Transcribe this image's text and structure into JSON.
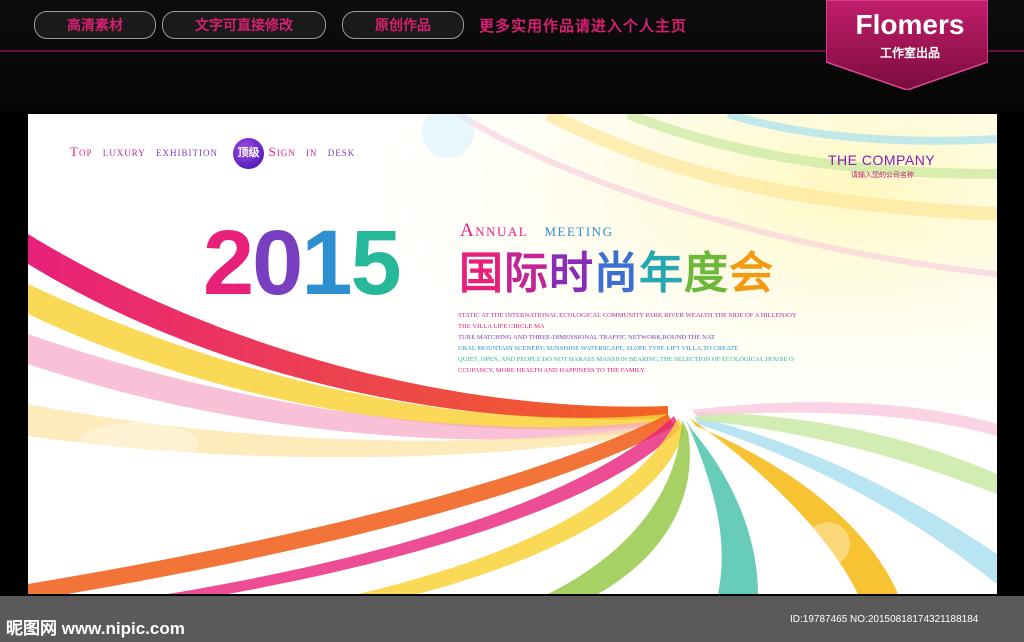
{
  "top_bar": {
    "pills": [
      "高清素材",
      "文字可直接修改",
      "原创作品"
    ],
    "promo_text": "更多实用作品请进入个人主页",
    "brand_name": "Flomers",
    "brand_sub": "工作室出品"
  },
  "board": {
    "luxury_words": [
      "Top",
      "luxury",
      "exhibition"
    ],
    "badge": "顶级",
    "sign_words": [
      "Sign",
      "in",
      "desk"
    ],
    "company": "THE COMPANY",
    "company_sub": "请输入您的公司名称",
    "year_digits": [
      "2",
      "0",
      "1",
      "5"
    ],
    "annual_words": [
      "Annual",
      "meeting"
    ],
    "title_chars": [
      "国",
      "际",
      "时",
      "尚",
      "年",
      "度",
      "会"
    ],
    "description_lines": [
      "STATIC AT THE INTERNATIONAL ECOLOGICAL COMMUNITY PARK RIVER WEALTH THE SIDE OF A HILLENJOY",
      "THE VILLA LIFE CIRCLE MA",
      "TURE MATCHING AND THREE-DIMENSIONAL TRAFFIC NETWORK,ROUND THE NAT",
      "URAL MOUNTAIN SCENERY, SUNSHINE WATERSCAPE, SLOPE TYPE LIFT VILLA,TO CREATE",
      "QUIET, OPEN, AND PEOPLE DO NOT HARASS MANSION BEARING,THE SELECTION OF ECOLOGICAL HOUSE O",
      "CCUPANCY, MORE HEALTH AND HAPPINESS TO THE FAMILY."
    ]
  },
  "watermark": {
    "logo": "昵图网 www.nipic.com",
    "id_text": "ID:19787465 NO:20150818174321188184"
  },
  "colors": {
    "magenta": "#d4206f",
    "purple": "#8a1ab5",
    "rainbow": [
      "#e8207a",
      "#b82aa8",
      "#7a3fc0",
      "#2d8fd0",
      "#27b89a",
      "#8ec63f",
      "#f5b400",
      "#f26522"
    ]
  }
}
